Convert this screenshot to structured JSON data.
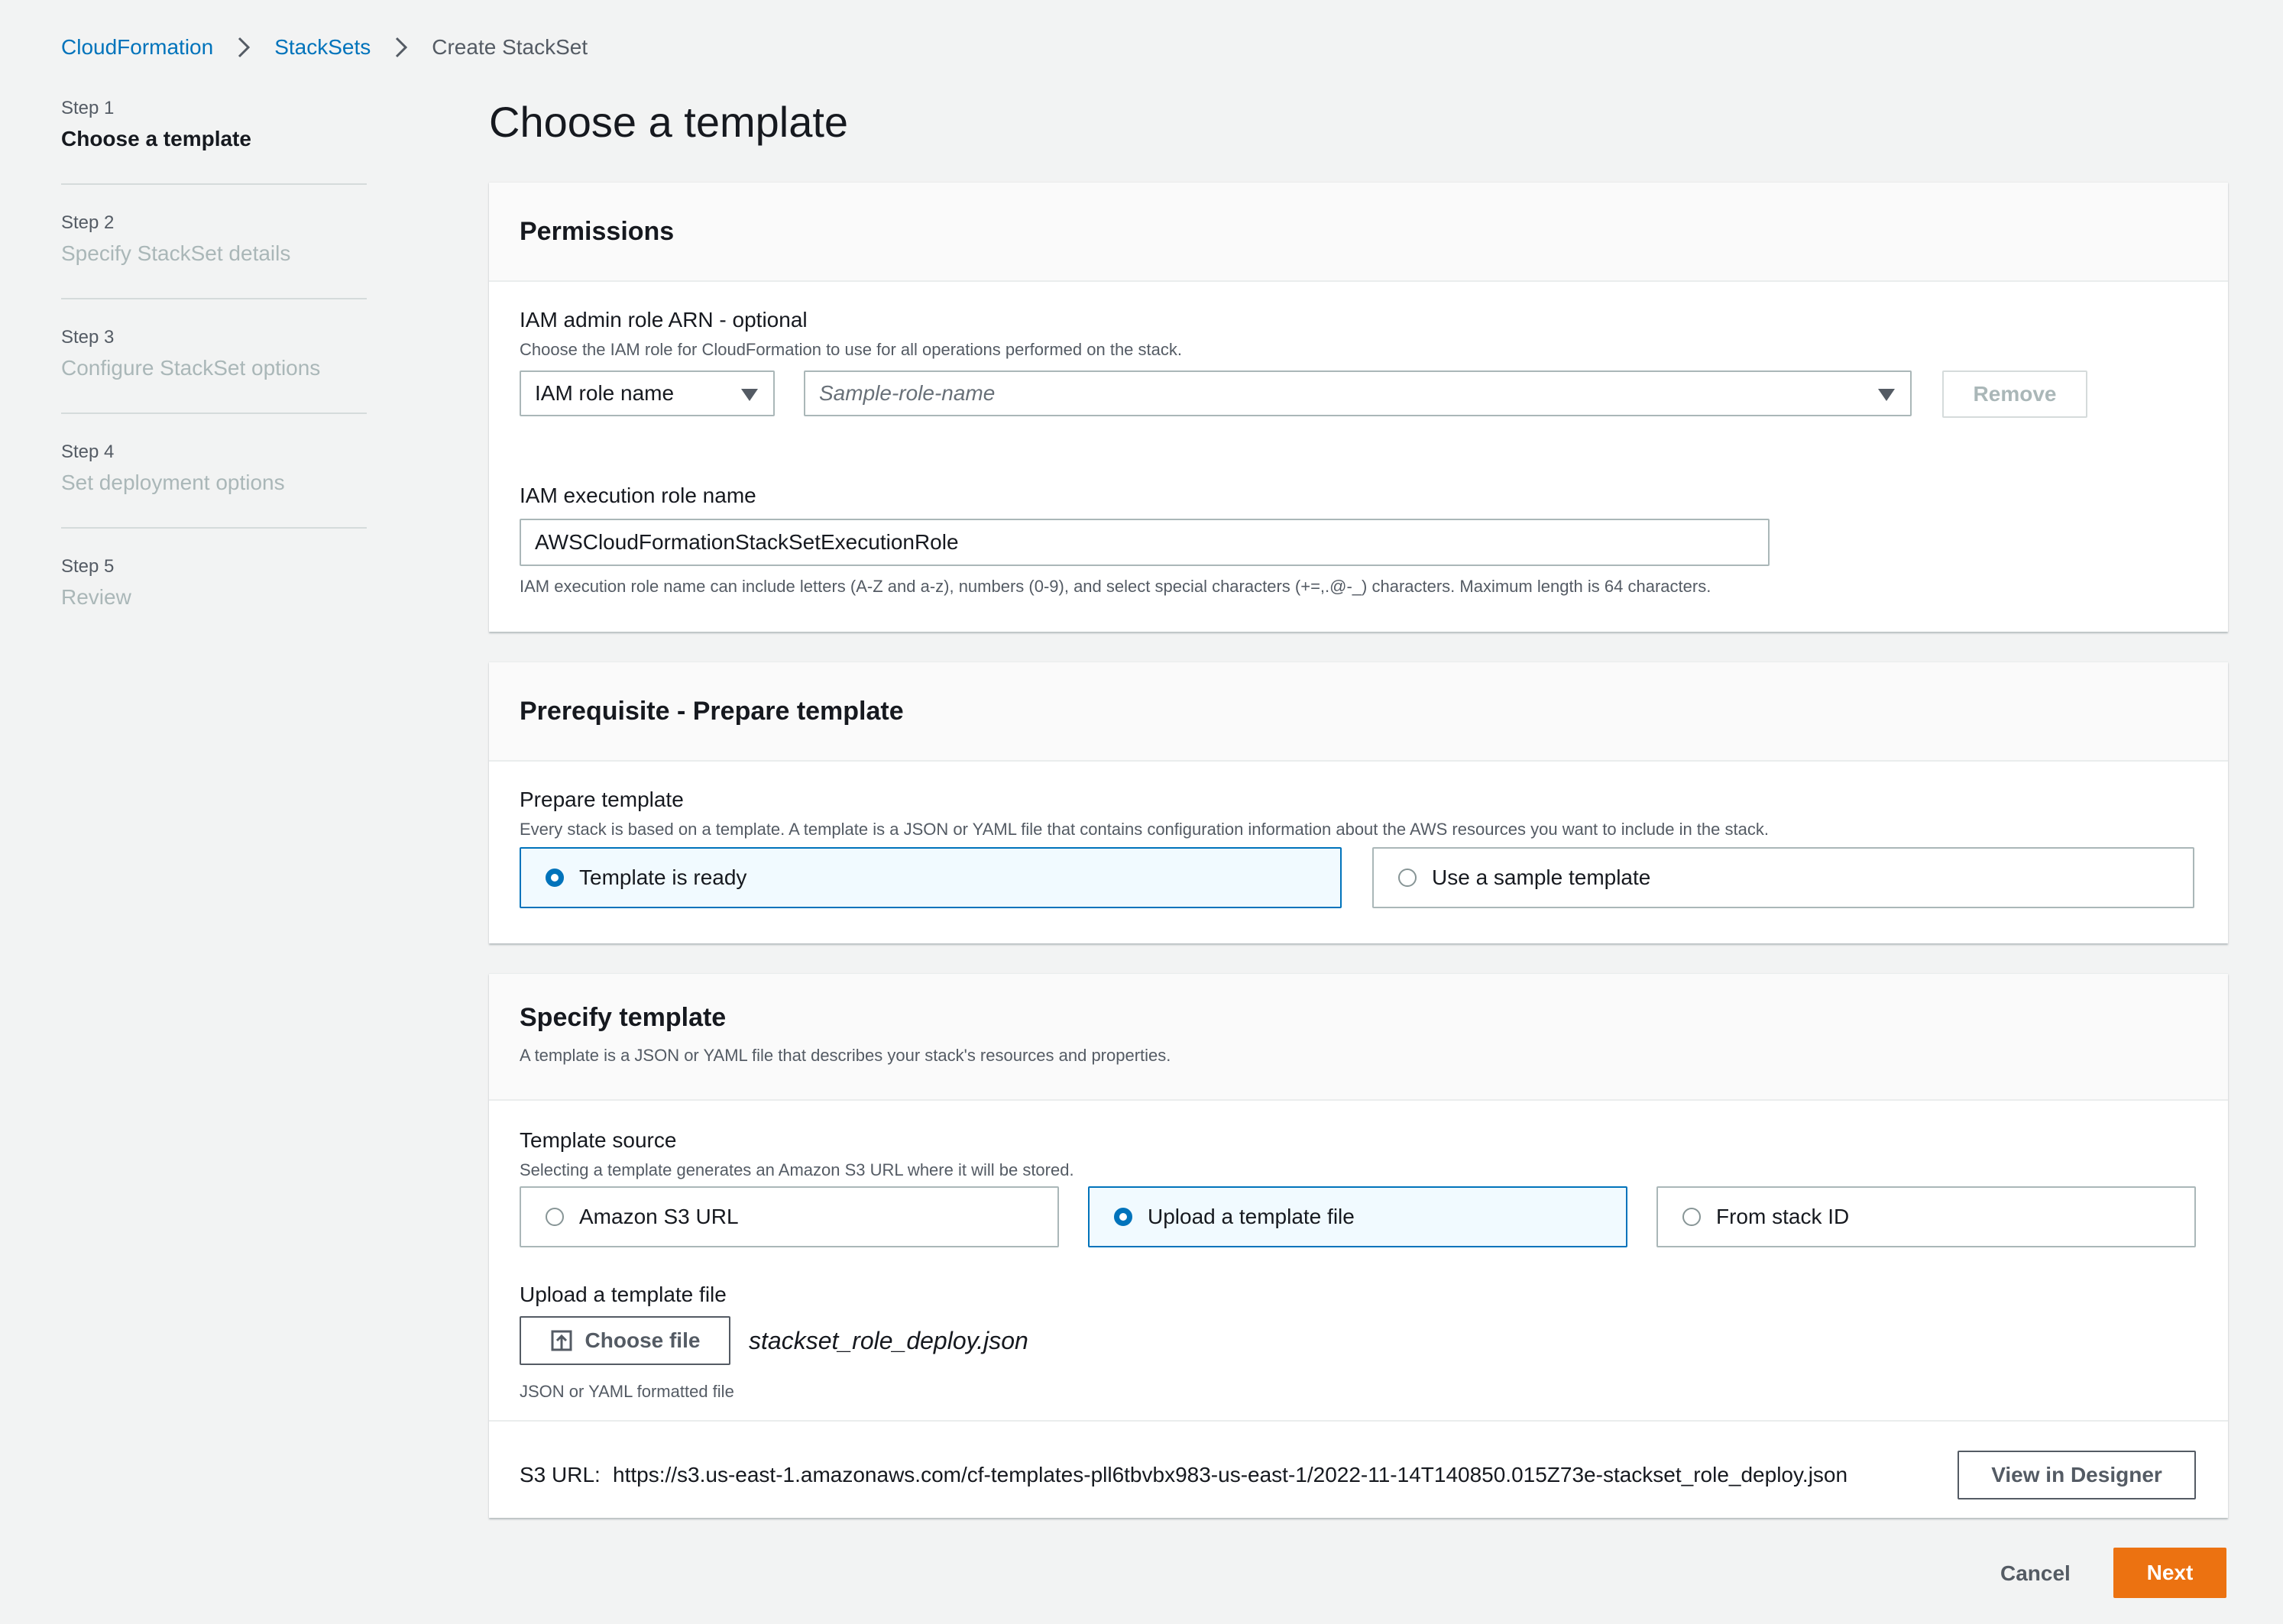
{
  "breadcrumb": {
    "items": [
      {
        "label": "CloudFormation"
      },
      {
        "label": "StackSets"
      },
      {
        "label": "Create StackSet"
      }
    ]
  },
  "steps": [
    {
      "number": "Step 1",
      "title": "Choose a template",
      "active": true
    },
    {
      "number": "Step 2",
      "title": "Specify StackSet details",
      "active": false
    },
    {
      "number": "Step 3",
      "title": "Configure StackSet options",
      "active": false
    },
    {
      "number": "Step 4",
      "title": "Set deployment options",
      "active": false
    },
    {
      "number": "Step 5",
      "title": "Review",
      "active": false
    }
  ],
  "page_title": "Choose a template",
  "permissions": {
    "title": "Permissions",
    "admin_role_label": "IAM admin role ARN - optional",
    "admin_role_desc": "Choose the IAM role for CloudFormation to use for all operations performed on the stack.",
    "role_type_value": "IAM role name",
    "role_name_placeholder": "Sample-role-name",
    "remove_label": "Remove",
    "exec_role_label": "IAM execution role name",
    "exec_role_value": "AWSCloudFormationStackSetExecutionRole",
    "exec_role_hint": "IAM execution role name can include letters (A-Z and a-z), numbers (0-9), and select special characters (+=,.@-_) characters. Maximum length is 64 characters."
  },
  "prerequisite": {
    "title": "Prerequisite - Prepare template",
    "label": "Prepare template",
    "desc": "Every stack is based on a template. A template is a JSON or YAML file that contains configuration information about the AWS resources you want to include in the stack.",
    "options": [
      {
        "label": "Template is ready",
        "selected": true
      },
      {
        "label": "Use a sample template",
        "selected": false
      }
    ]
  },
  "specify": {
    "title": "Specify template",
    "desc": "A template is a JSON or YAML file that describes your stack's resources and properties.",
    "source_label": "Template source",
    "source_desc": "Selecting a template generates an Amazon S3 URL where it will be stored.",
    "sources": [
      {
        "label": "Amazon S3 URL",
        "selected": false
      },
      {
        "label": "Upload a template file",
        "selected": true
      },
      {
        "label": "From stack ID",
        "selected": false
      }
    ],
    "upload_label": "Upload a template file",
    "choose_file_label": "Choose file",
    "file_name": "stackset_role_deploy.json",
    "file_hint": "JSON or YAML formatted file",
    "s3_url_label": "S3 URL:",
    "s3_url_value": "https://s3.us-east-1.amazonaws.com/cf-templates-pll6tbvbx983-us-east-1/2022-11-14T140850.015Z73e-stackset_role_deploy.json",
    "view_designer_label": "View in Designer"
  },
  "footer": {
    "cancel_label": "Cancel",
    "next_label": "Next"
  },
  "colors": {
    "link": "#0073bb",
    "primary": "#ec7211",
    "selected_tile_bg": "#f1faff",
    "background": "#f2f3f3"
  }
}
